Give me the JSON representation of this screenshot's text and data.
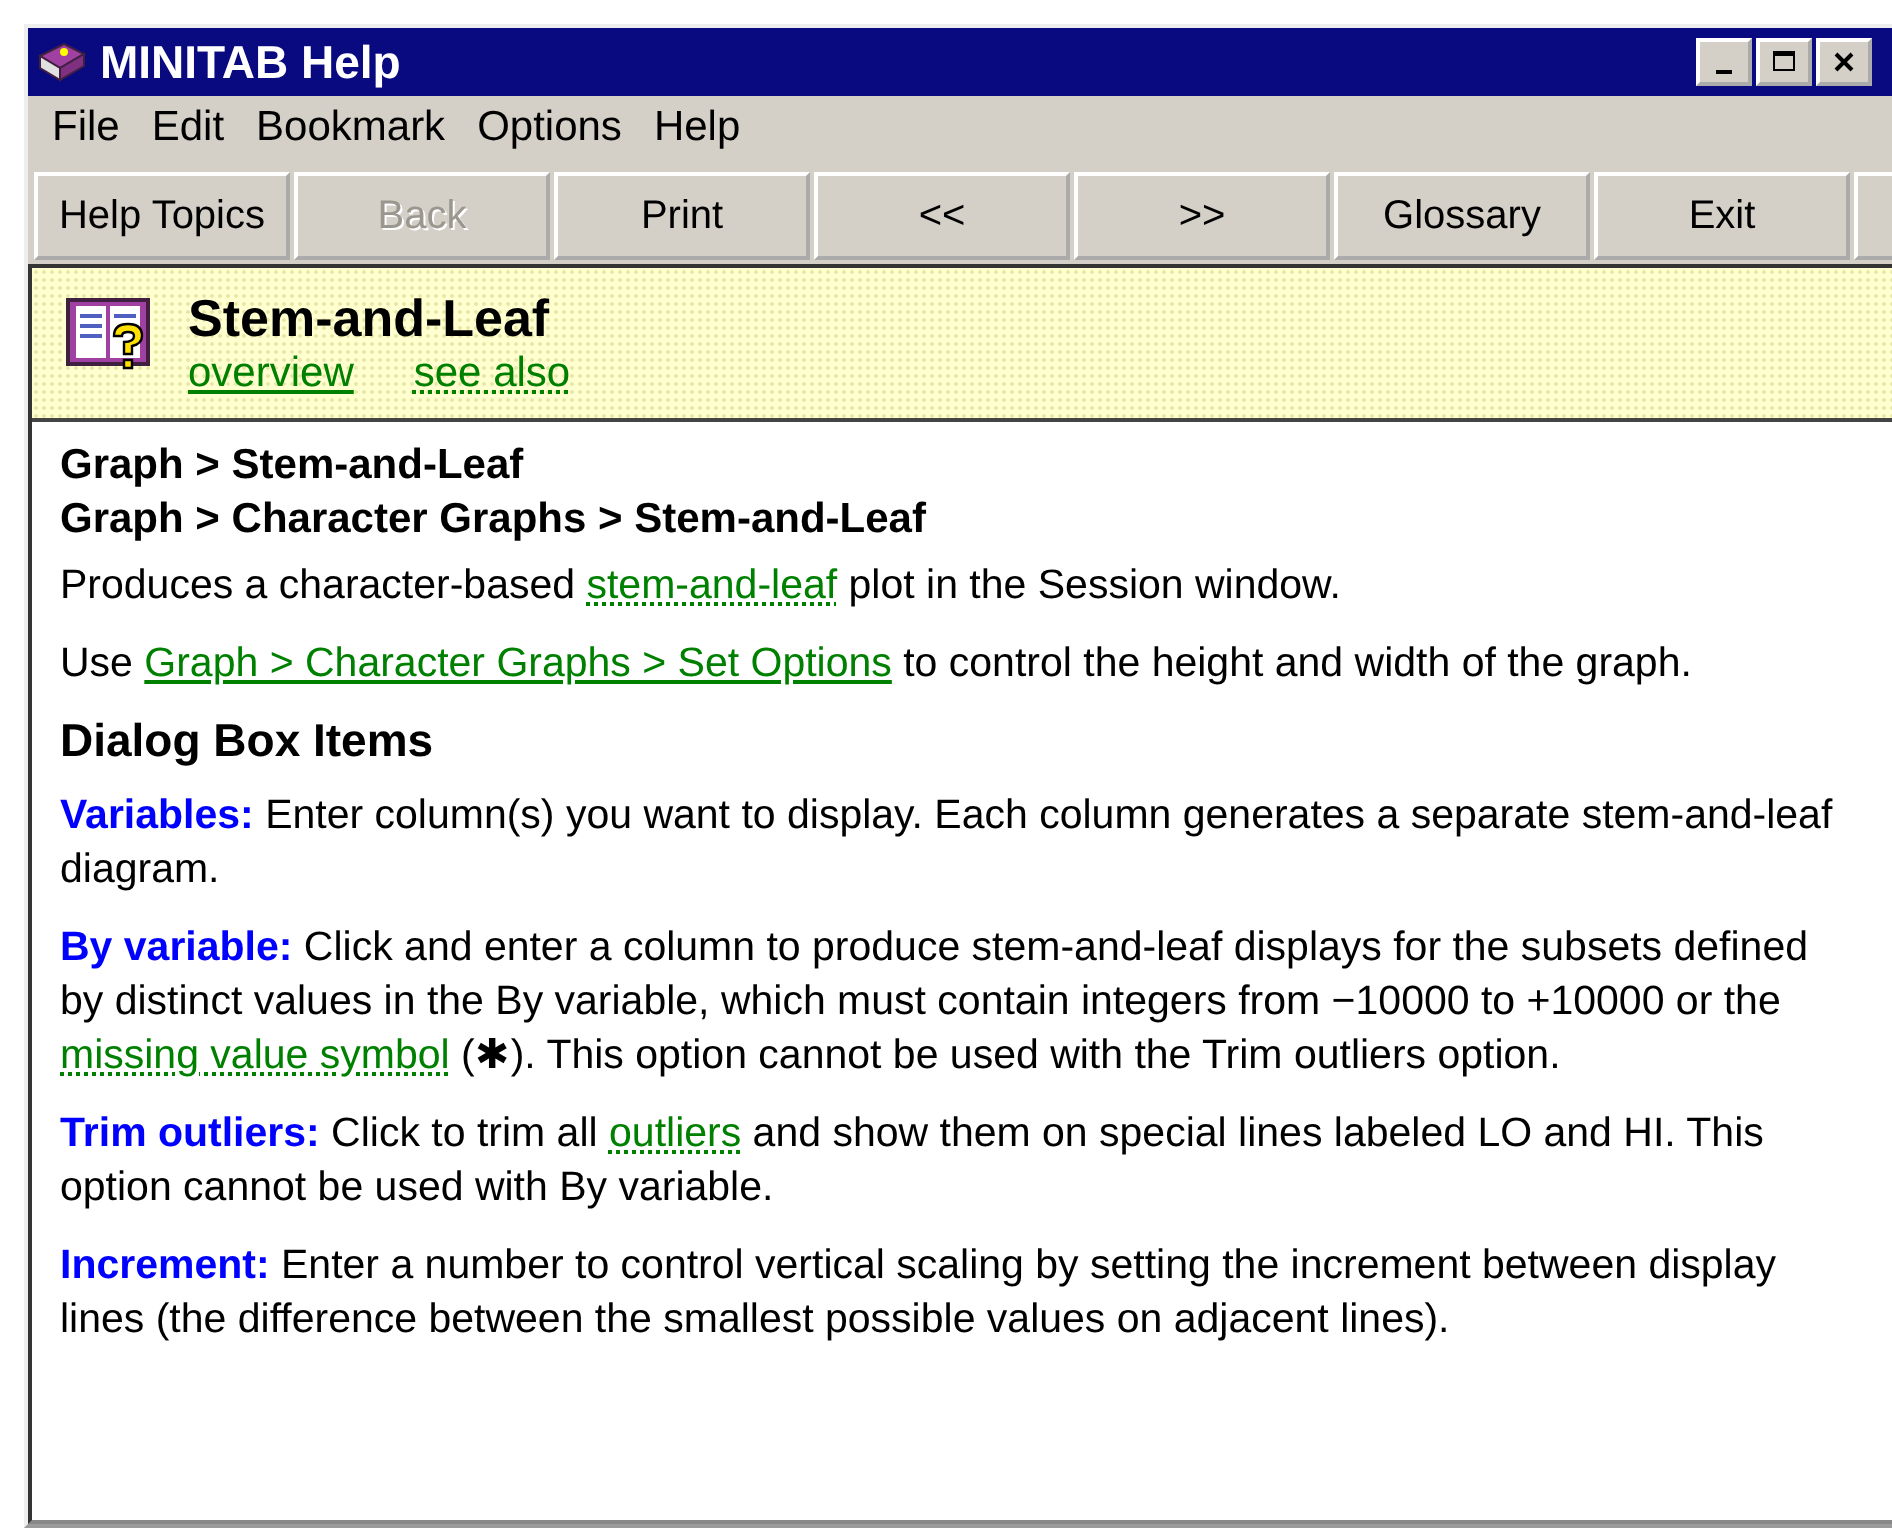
{
  "window": {
    "title": "MINITAB Help"
  },
  "menu": [
    "File",
    "Edit",
    "Bookmark",
    "Options",
    "Help"
  ],
  "toolbar": [
    {
      "label": "Help Topics",
      "disabled": false
    },
    {
      "label": "Back",
      "disabled": true
    },
    {
      "label": "Print",
      "disabled": false
    },
    {
      "label": "<<",
      "disabled": false
    },
    {
      "label": ">>",
      "disabled": false
    },
    {
      "label": "Glossary",
      "disabled": false
    },
    {
      "label": "Exit",
      "disabled": false
    }
  ],
  "header": {
    "title": "Stem-and-Leaf",
    "links": [
      {
        "text": "overview",
        "kind": "link"
      },
      {
        "text": "see also",
        "kind": "popup"
      }
    ]
  },
  "paths": [
    "Graph > Stem-and-Leaf",
    "Graph > Character Graphs > Stem-and-Leaf"
  ],
  "paragraphs": [
    [
      {
        "kind": "plain",
        "text": "Produces a character-based "
      },
      {
        "kind": "popup",
        "text": "stem-and-leaf"
      },
      {
        "kind": "plain",
        "text": " plot in the Session window."
      }
    ],
    [
      {
        "kind": "plain",
        "text": "Use "
      },
      {
        "kind": "link",
        "text": "Graph > Character Graphs > Set Options"
      },
      {
        "kind": "plain",
        "text": " to control the height and width of the graph."
      }
    ]
  ],
  "section_title": "Dialog Box Items",
  "items": [
    [
      {
        "kind": "term",
        "text": "Variables:"
      },
      {
        "kind": "plain",
        "text": " Enter column(s) you want to display. Each column generates a separate stem-and-leaf diagram."
      }
    ],
    [
      {
        "kind": "term",
        "text": "By variable:"
      },
      {
        "kind": "plain",
        "text": " Click and enter a column to produce stem-and-leaf displays for the subsets defined by distinct values in the By variable, which must contain integers from −10000 to +10000 or the "
      },
      {
        "kind": "popup",
        "text": "missing value symbol"
      },
      {
        "kind": "plain",
        "text": " (✱). This option cannot be used with the Trim outliers option."
      }
    ],
    [
      {
        "kind": "term",
        "text": "Trim outliers:"
      },
      {
        "kind": "plain",
        "text": " Click to trim all "
      },
      {
        "kind": "popup",
        "text": "outliers"
      },
      {
        "kind": "plain",
        "text": " and show them on special lines labeled LO and HI. This option cannot be used with By variable."
      }
    ],
    [
      {
        "kind": "term",
        "text": "Increment:"
      },
      {
        "kind": "plain",
        "text": " Enter a number to control vertical scaling by setting the increment between display lines (the difference between the smallest possible values on adjacent lines)."
      }
    ]
  ]
}
